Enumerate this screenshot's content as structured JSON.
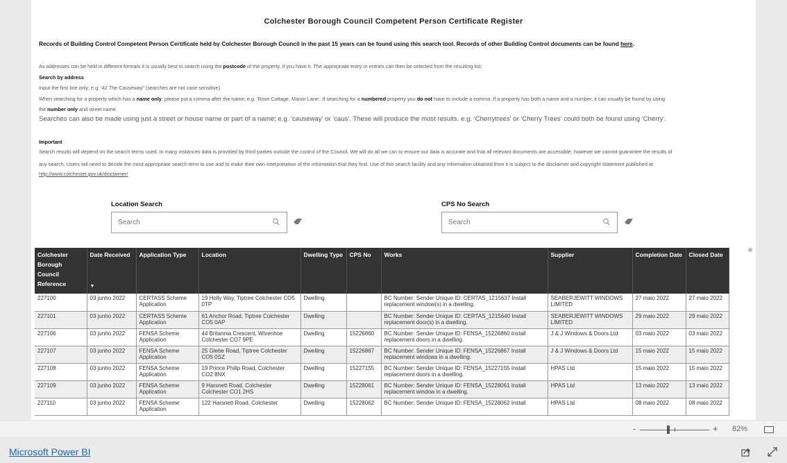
{
  "report": {
    "title": "Colchester Borough Council Competent Person Certificate Register",
    "intro": "Records of Building Control Competent Person Certificate held by Colchester Borough Council in the past 15 years can be found using this search tool.  Records of other Building Control documents can be found ",
    "intro_link": "here",
    "intro_end": ".",
    "p1a": "As addresses can be held in different formats it is usually best to search using the ",
    "p1b": "postcode",
    "p1c": " of the property, if you have it. The appropriate entry or entries can then be selected from the resulting list:",
    "search_by_address": "Search by address",
    "p2": "Input the first line only; e.g. '42 The Causeway\" (searches are not case sensitive)",
    "p3a": "When searching for a property which has a ",
    "p3b": "name only",
    "p3c": ", please put a comma after the name; e.g. 'Rose Cottage, Manor Lane'.  If searching for a ",
    "p3d": "numbered",
    "p3e": " property you ",
    "p3f": "do not",
    "p3g": " have to include a comma.  If a property has both a name and a number, it can usually be found by using",
    "p4a": "the ",
    "p4b": "number only",
    "p4c": " and street name.",
    "p5": "Searches can also be made using just a street or house name or part of a name; e.g. 'causeway' or 'caus'.  These will produce the most results. e.g. 'Cherrytrees' or 'Cherry Trees' could both be found using 'Cherry'.",
    "important": "Important",
    "p6": "Search results will depend on the search terms used. In many instances data is provided by third-parties outside the control of the Council. We will do all we can to ensure our data is accurate and that all relevant documents are accessible, however we cannot guarantee the results of",
    "p7": "any search.  Users will need to decide the most appropriate search term to use and to make their own interpretation of the information that they find. Use of this search facility and any information obtained from it is subject to the disclaimer and copyright statement published at",
    "disclaimer_link": "http://www.colchester.gov.uk/disclaimer/"
  },
  "location_search": {
    "label": "Location Search",
    "placeholder": "Search"
  },
  "cps_search": {
    "label": "CPS No Search",
    "placeholder": "Search"
  },
  "table": {
    "headers": [
      "Colchester Borough Council Reference",
      "Date Received",
      "Application Type",
      "Location",
      "Dwelling Type",
      "CPS No",
      "Works",
      "Supplier",
      "Completion Date",
      "Closed Date"
    ],
    "sorted_column": "Date Received",
    "rows": [
      [
        "227100",
        "03 junho 2022",
        "CERTASS Scheme Application",
        "19 Holly Way, Tiptree Colchester CO5 0TP",
        "Dwelling",
        "",
        "BC Number: Sender Unique ID: CERTAS_1215637 Install replacement window(s) in a dwelling.",
        "SEABERJEWITT WINDOWS LIMITED",
        "27 maio 2022",
        "27 maio 2022"
      ],
      [
        "227101",
        "03 junho 2022",
        "CERTASS Scheme Application",
        "61 Anchor Road, Tiptree Colchester CO5 0AP",
        "Dwelling",
        "",
        "BC Number: Sender Unique ID: CERTAS_1215640 Install replacement door(s) in a dwelling.",
        "SEABERJEWITT WINDOWS LIMITED",
        "29 maio 2022",
        "29 maio 2022"
      ],
      [
        "227106",
        "03 junho 2022",
        "FENSA Scheme Application",
        "44 Britannia Crescent, Wivenhoe Colchester CO7 9PE",
        "Dwelling",
        "15226860",
        "BC Number: Sender Unique ID: FENSA_15226860 Install replacement doors in a dwelling.",
        "J & J Windows & Doors Ltd",
        "03 maio 2022",
        "03 maio 2022"
      ],
      [
        "227107",
        "03 junho 2022",
        "FENSA Scheme Application",
        "25 Glebe Road, Tiptree Colchester CO5 0SZ",
        "Dwelling",
        "15226867",
        "BC Number: Sender Unique ID: FENSA_15226867 Install replacement windows in a dwelling.",
        "J & J Windows & Doors Ltd",
        "15 maio 2022",
        "15 maio 2022"
      ],
      [
        "227108",
        "03 junho 2022",
        "FENSA Scheme Application",
        "19 Prince Philip Road, Colchester CO2 8NX",
        "Dwelling",
        "15227155",
        "BC Number: Sender Unique ID: FENSA_15227155 Install replacement doors in a dwelling.",
        "HPAS Ltd",
        "15 maio 2022",
        "15 maio 2022"
      ],
      [
        "227109",
        "03 junho 2022",
        "FENSA Scheme Application",
        "9 Harsnett Road, Colchester Colchester CO1 2HS",
        "Dwelling",
        "15228061",
        "BC Number: Sender Unique ID: FENSA_15228061 Install replacement window in a dwelling.",
        "HPAS Ltd",
        "13 maio 2022",
        "13 maio 2022"
      ],
      [
        "227110",
        "03 junho 2022",
        "FENSA Scheme Application",
        "122 Harsnett Road, Colchester",
        "Dwelling",
        "15228062",
        "BC Number: Sender Unique ID: FENSA_15228062 Install",
        "HPAS Ltd",
        "08 maio 2022",
        "08 maio 2022"
      ]
    ]
  },
  "zoom": {
    "minus": "-",
    "plus": "+",
    "level": "82%",
    "value_percent": 82
  },
  "footer": {
    "brand": "Microsoft Power BI"
  },
  "colors": {
    "header_bg": "#333333",
    "brand": "#1a6aa8"
  }
}
